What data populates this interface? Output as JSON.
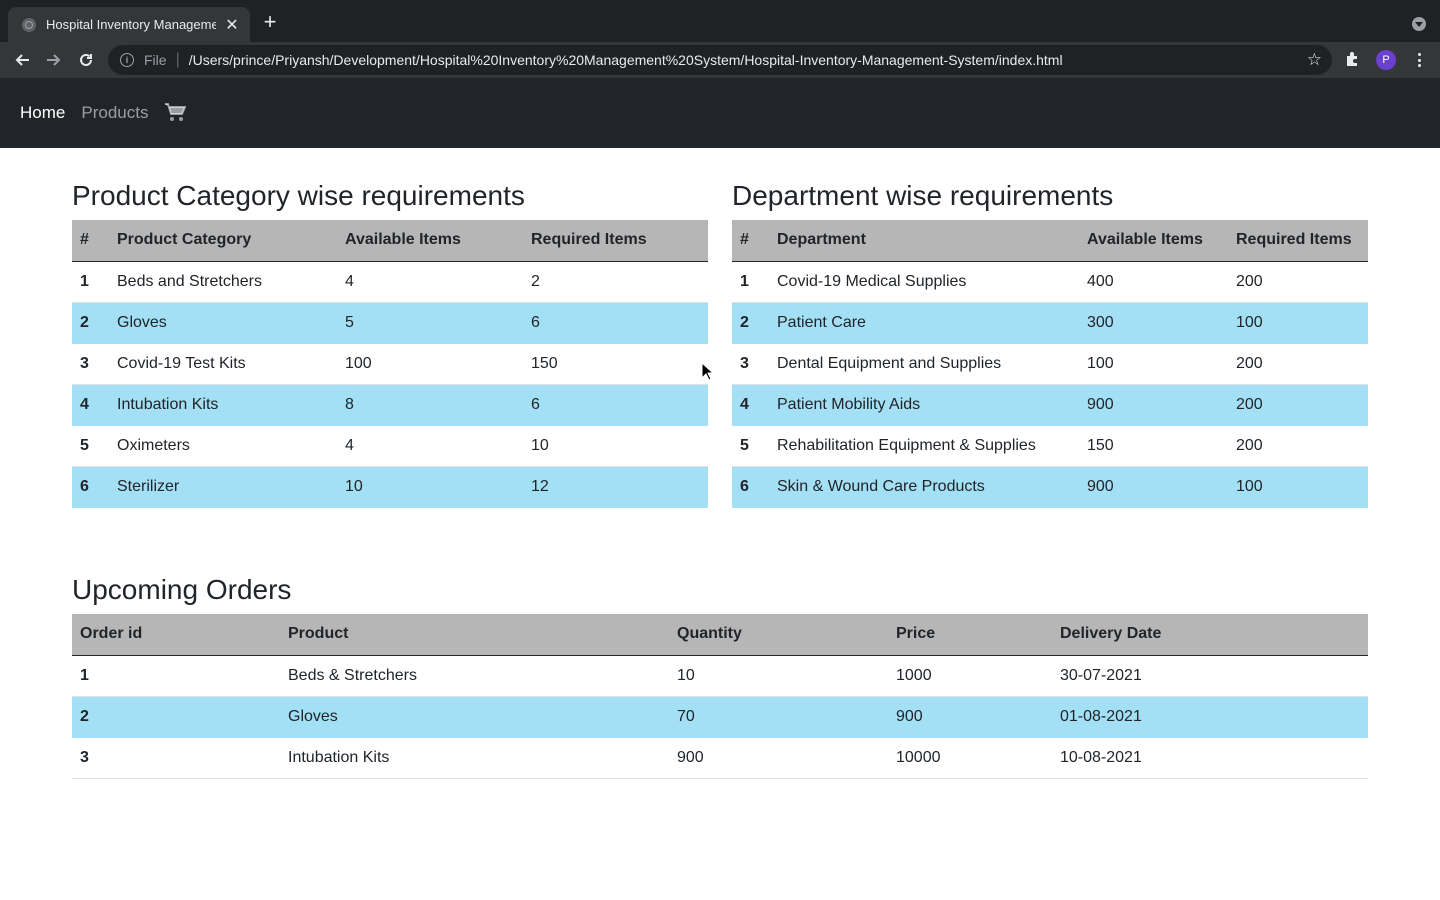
{
  "browser": {
    "tab_title": "Hospital Inventory Managemen",
    "scheme_label": "File",
    "url": "/Users/prince/Priyansh/Development/Hospital%20Inventory%20Management%20System/Hospital-Inventory-Management-System/index.html",
    "profile_initial": "P"
  },
  "nav": {
    "home": "Home",
    "products": "Products"
  },
  "category_table": {
    "title": "Product Category wise requirements",
    "headers": [
      "#",
      "Product Category",
      "Available Items",
      "Required Items"
    ],
    "rows": [
      [
        "1",
        "Beds and Stretchers",
        "4",
        "2"
      ],
      [
        "2",
        "Gloves",
        "5",
        "6"
      ],
      [
        "3",
        "Covid-19 Test Kits",
        "100",
        "150"
      ],
      [
        "4",
        "Intubation Kits",
        "8",
        "6"
      ],
      [
        "5",
        "Oximeters",
        "4",
        "10"
      ],
      [
        "6",
        "Sterilizer",
        "10",
        "12"
      ]
    ]
  },
  "department_table": {
    "title": "Department wise requirements",
    "headers": [
      "#",
      "Department",
      "Available Items",
      "Required Items"
    ],
    "rows": [
      [
        "1",
        "Covid-19 Medical Supplies",
        "400",
        "200"
      ],
      [
        "2",
        "Patient Care",
        "300",
        "100"
      ],
      [
        "3",
        "Dental Equipment and Supplies",
        "100",
        "200"
      ],
      [
        "4",
        "Patient Mobility Aids",
        "900",
        "200"
      ],
      [
        "5",
        "Rehabilitation Equipment & Supplies",
        "150",
        "200"
      ],
      [
        "6",
        "Skin & Wound Care Products",
        "900",
        "100"
      ]
    ]
  },
  "orders_table": {
    "title": "Upcoming Orders",
    "headers": [
      "Order id",
      "Product",
      "Quantity",
      "Price",
      "Delivery Date"
    ],
    "rows": [
      [
        "1",
        "Beds & Stretchers",
        "10",
        "1000",
        "30-07-2021"
      ],
      [
        "2",
        "Gloves",
        "70",
        "900",
        "01-08-2021"
      ],
      [
        "3",
        "Intubation Kits",
        "900",
        "10000",
        "10-08-2021"
      ]
    ]
  },
  "colors": {
    "navbar": "#212529",
    "table_header": "#b6b6b6",
    "stripe": "#a3dff5"
  }
}
